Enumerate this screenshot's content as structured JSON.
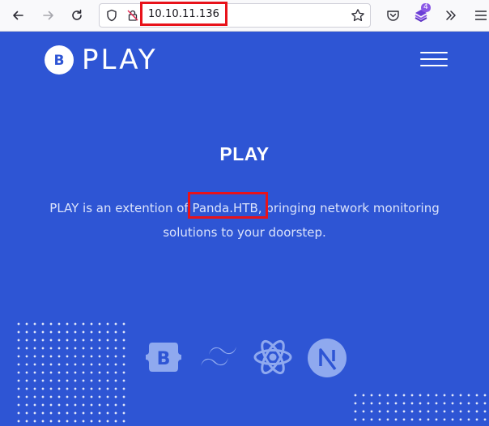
{
  "browser": {
    "url": "10.10.11.136",
    "extension_badge": "4",
    "icons": [
      "back-arrow-icon",
      "forward-arrow-icon",
      "reload-icon",
      "shield-icon",
      "insecure-lock-icon",
      "bookmark-star-icon",
      "pocket-icon",
      "extension-icon",
      "overflow-chevrons-icon"
    ]
  },
  "site": {
    "brand_letter": "B",
    "brand_name": "PLAY",
    "hero": {
      "title": "PLAY",
      "desc_before": "PLAY is an extention of ",
      "desc_highlight": "Panda.HTB",
      "desc_line1_after": ", bringing network monitoring",
      "desc_line2": "solutions to your doorstep."
    },
    "tech_icons": [
      "bootstrap-icon",
      "tailwind-icon",
      "react-icon",
      "nextjs-icon"
    ]
  },
  "colors": {
    "page_bg": "#2e55d4",
    "highlight_box": "#e8121a",
    "tech_icon": "#8fa9ef"
  }
}
